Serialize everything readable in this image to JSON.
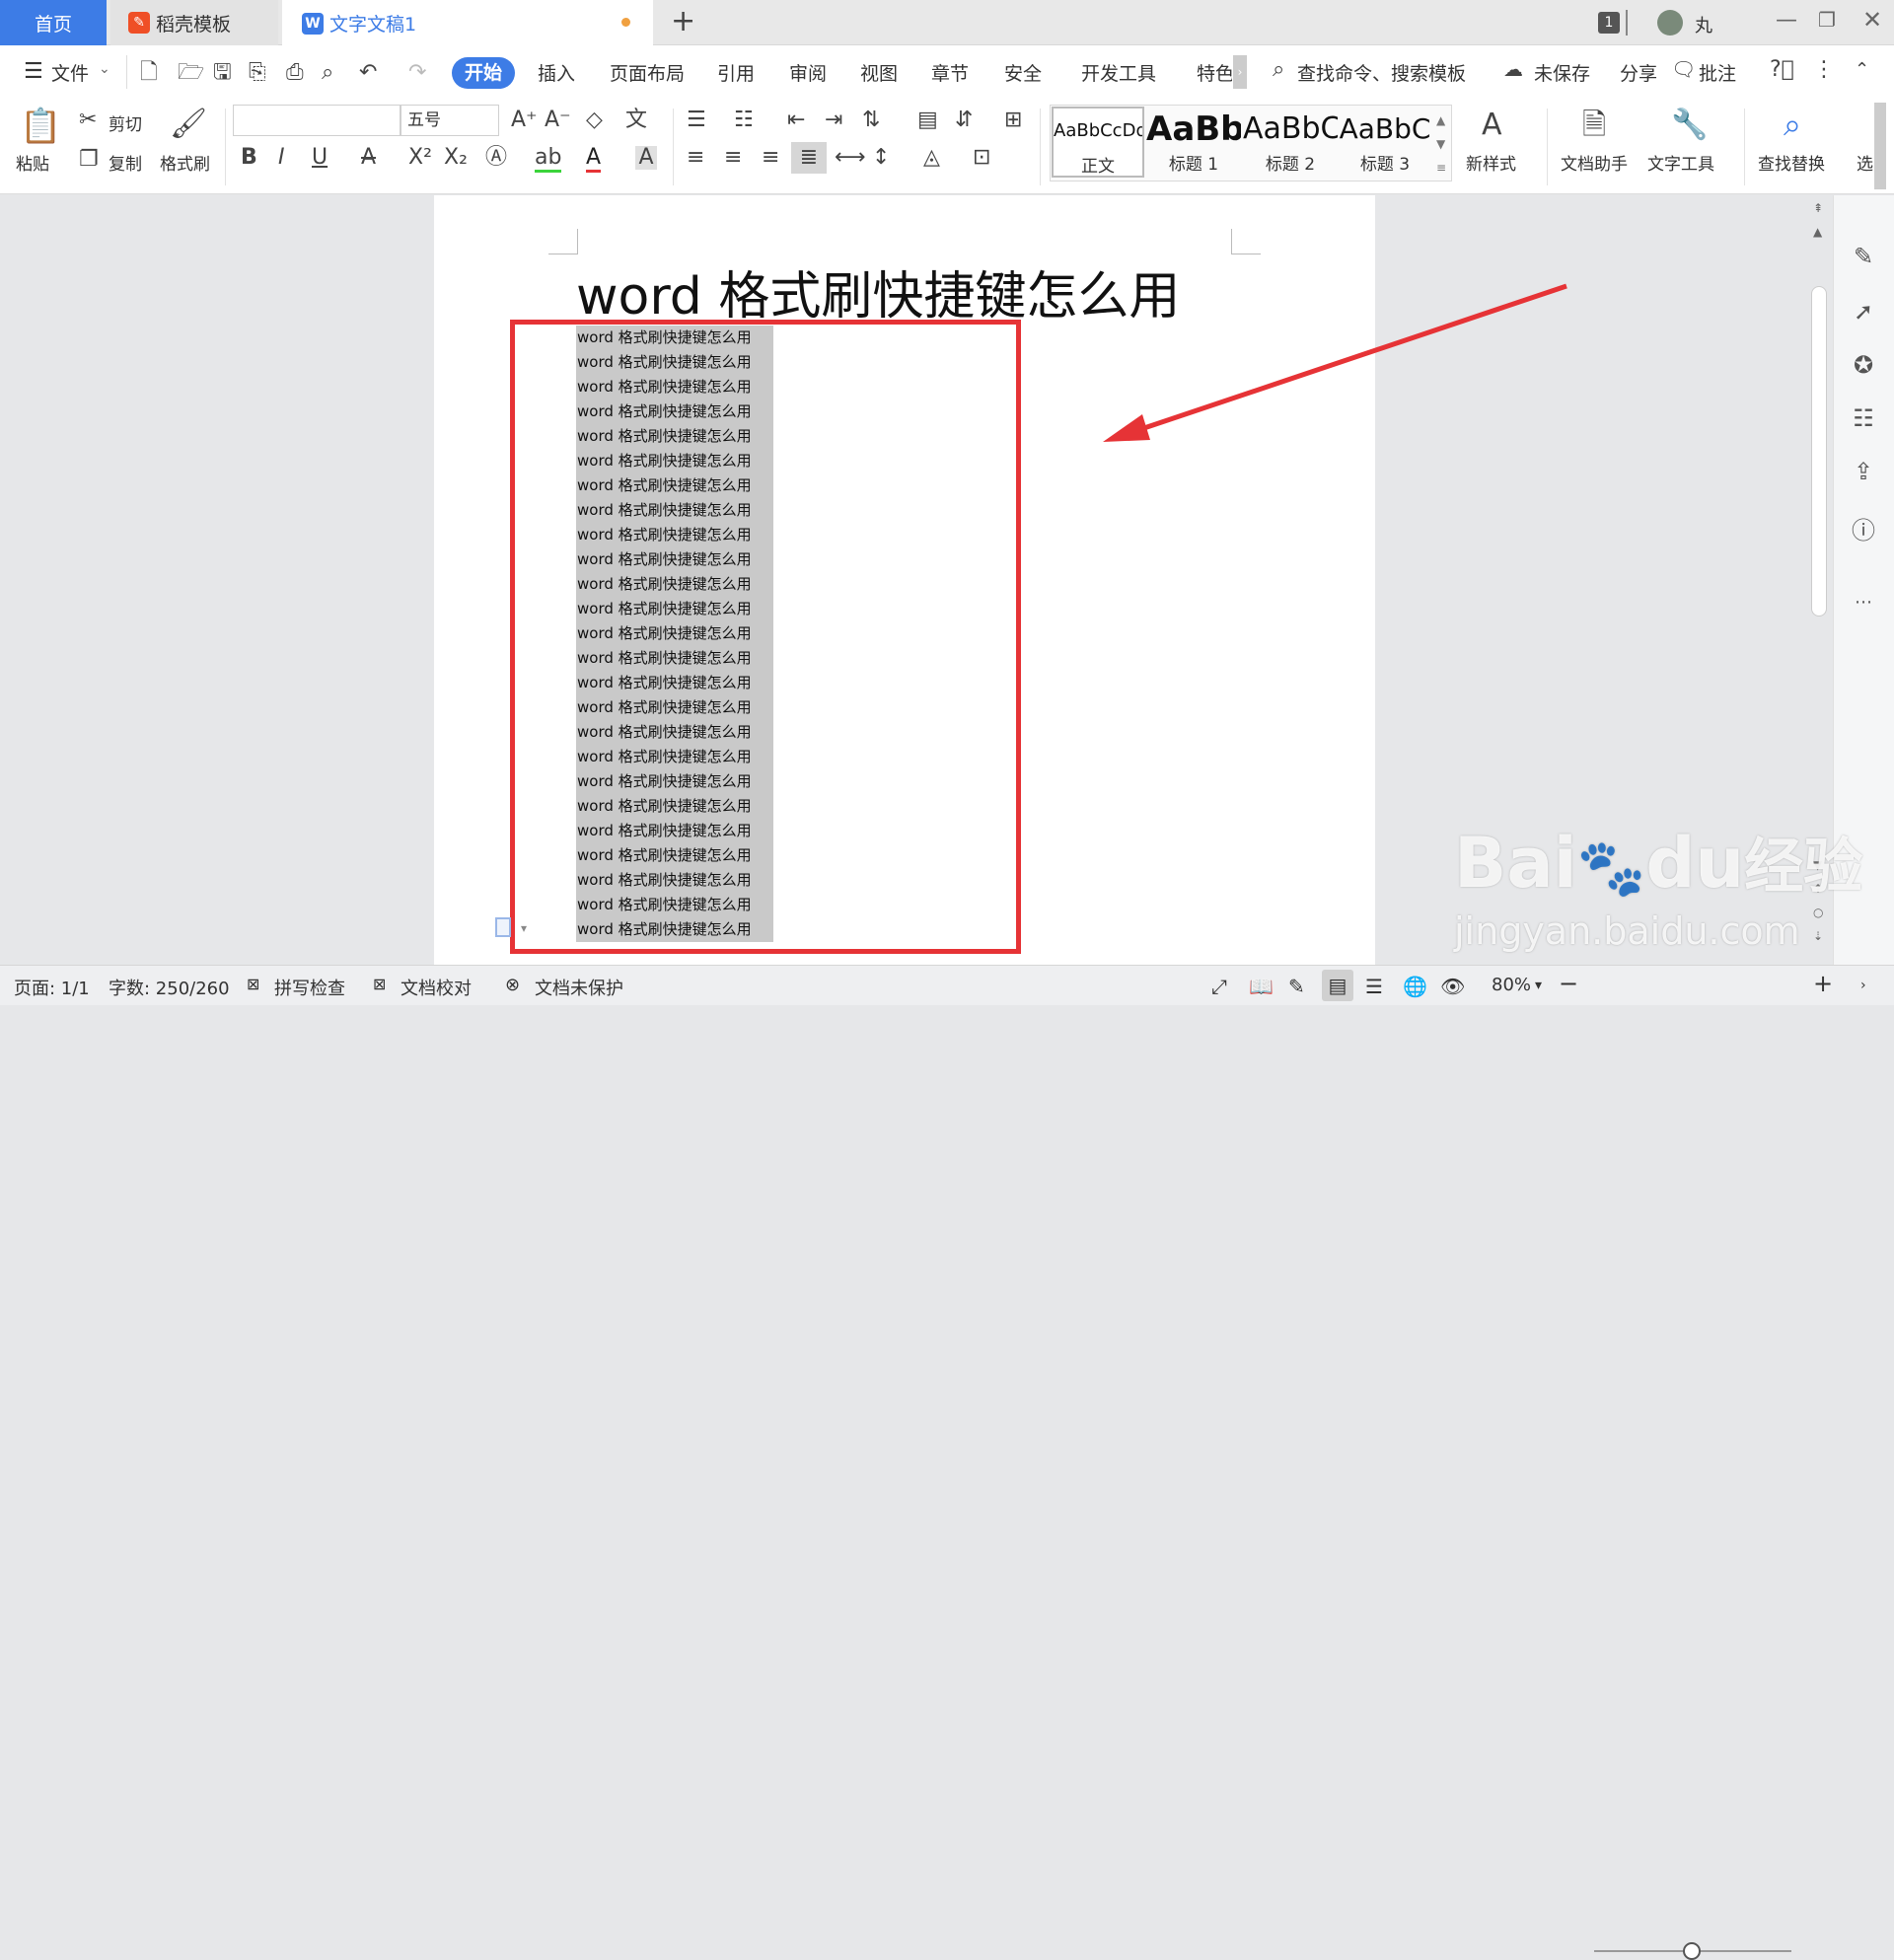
{
  "tabs": {
    "home": "首页",
    "template": "稻壳模板",
    "doc": "文字文稿1",
    "doc_logo": "W",
    "add": "+",
    "badge": "1",
    "user": "丸"
  },
  "menu": {
    "file": "文件",
    "items": [
      "开始",
      "插入",
      "页面布局",
      "引用",
      "审阅",
      "视图",
      "章节",
      "安全",
      "开发工具",
      "特色"
    ],
    "search": "查找命令、搜索模板",
    "unsaved": "未保存",
    "share": "分享",
    "comment": "批注"
  },
  "ribbon": {
    "paste": "粘贴",
    "cut": "剪切",
    "copy": "复制",
    "format_painter": "格式刷",
    "font_name": "",
    "font_size": "五号",
    "styles": [
      {
        "preview": "AaBbCcDd",
        "label": "正文"
      },
      {
        "preview": "AaBb",
        "label": "标题 1"
      },
      {
        "preview": "AaBbC",
        "label": "标题 2"
      },
      {
        "preview": "AaBbC",
        "label": "标题 3"
      }
    ],
    "new_style": "新样式",
    "doc_assistant": "文档助手",
    "text_tool": "文字工具",
    "find_replace": "查找替换",
    "select": "选"
  },
  "document": {
    "title": "word 格式刷快捷键怎么用",
    "lines": [
      "word 格式刷快捷键怎么用",
      "word 格式刷快捷键怎么用",
      "word 格式刷快捷键怎么用",
      "word 格式刷快捷键怎么用",
      "word 格式刷快捷键怎么用",
      "word 格式刷快捷键怎么用",
      "word 格式刷快捷键怎么用",
      "word 格式刷快捷键怎么用",
      "word 格式刷快捷键怎么用",
      "word 格式刷快捷键怎么用",
      "word 格式刷快捷键怎么用",
      "word 格式刷快捷键怎么用",
      "word 格式刷快捷键怎么用",
      "word 格式刷快捷键怎么用",
      "word 格式刷快捷键怎么用",
      "word 格式刷快捷键怎么用",
      "word 格式刷快捷键怎么用",
      "word 格式刷快捷键怎么用",
      "word 格式刷快捷键怎么用",
      "word 格式刷快捷键怎么用",
      "word 格式刷快捷键怎么用",
      "word 格式刷快捷键怎么用",
      "word 格式刷快捷键怎么用",
      "word 格式刷快捷键怎么用",
      "word 格式刷快捷键怎么用"
    ],
    "highlight_color": "#c9c9c9",
    "annotation_color": "#e63336"
  },
  "status": {
    "page": "页面: 1/1",
    "word_count": "字数: 250/260",
    "spell_check": "拼写检查",
    "proofread": "文档校对",
    "unprotected": "文档未保护",
    "zoom": "80%",
    "zoom_fraction": 0.8
  },
  "watermark": {
    "brand": "Bai",
    "brand2": "du",
    "suffix": "经验",
    "url": "jingyan.baidu.com"
  },
  "colors": {
    "accent": "#3d7ce6",
    "wps_orange": "#ef4f26"
  }
}
